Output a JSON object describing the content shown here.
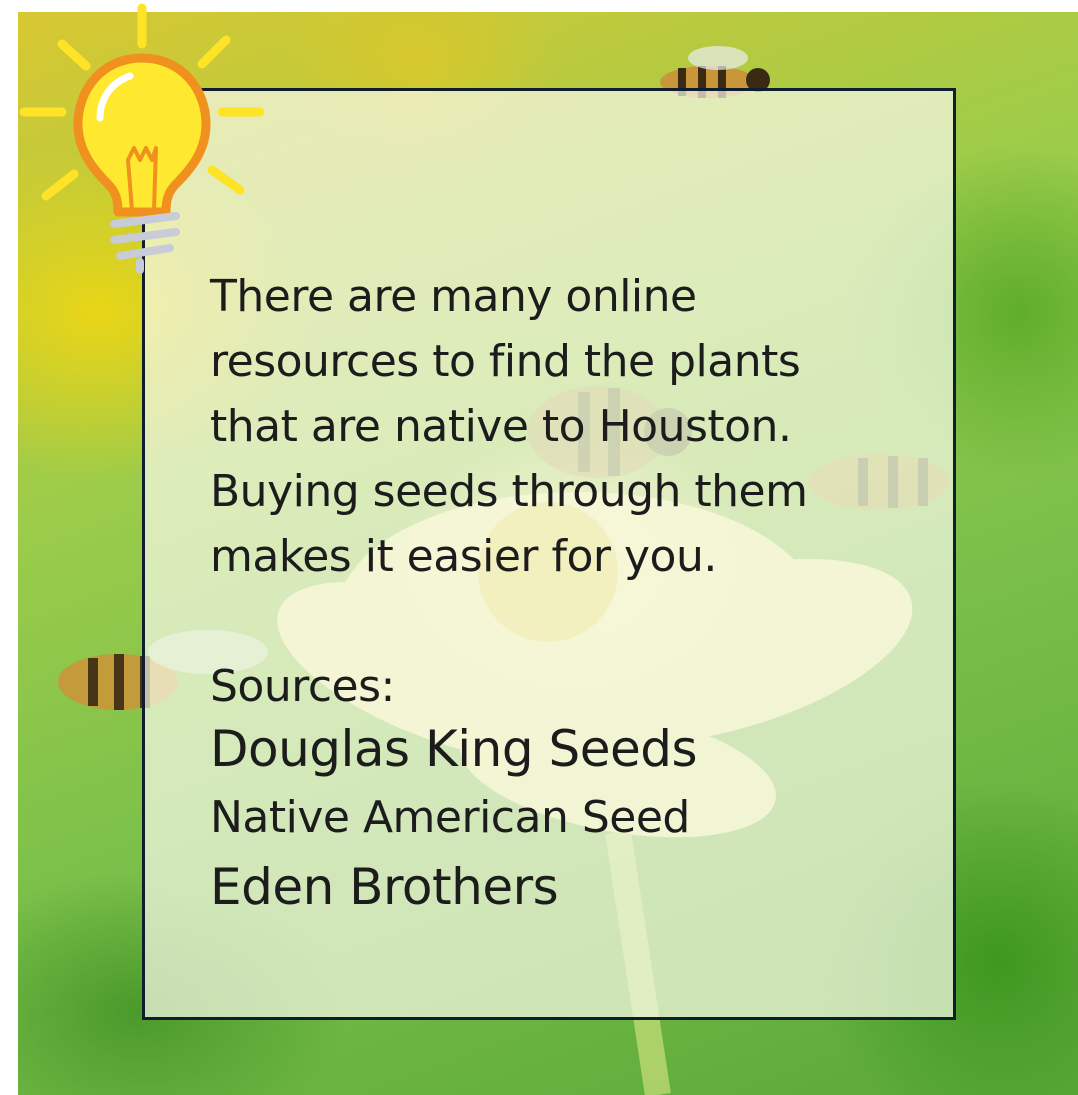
{
  "card": {
    "lines": [
      "There are many online",
      "resources to find the plants",
      "that are native to Houston.",
      "Buying seeds through them",
      "makes it easier for you."
    ],
    "sources_label": "Sources:",
    "sources": [
      "Douglas King Seeds",
      "Native American Seed",
      "Eden Brothers"
    ]
  },
  "icons": {
    "idea": "lightbulb-icon"
  },
  "colors": {
    "border": "#0e1e2e",
    "text": "#1c1c1c",
    "bulb_yellow": "#ffe930",
    "bulb_outline": "#f0901e",
    "rays": "#ffe326"
  }
}
